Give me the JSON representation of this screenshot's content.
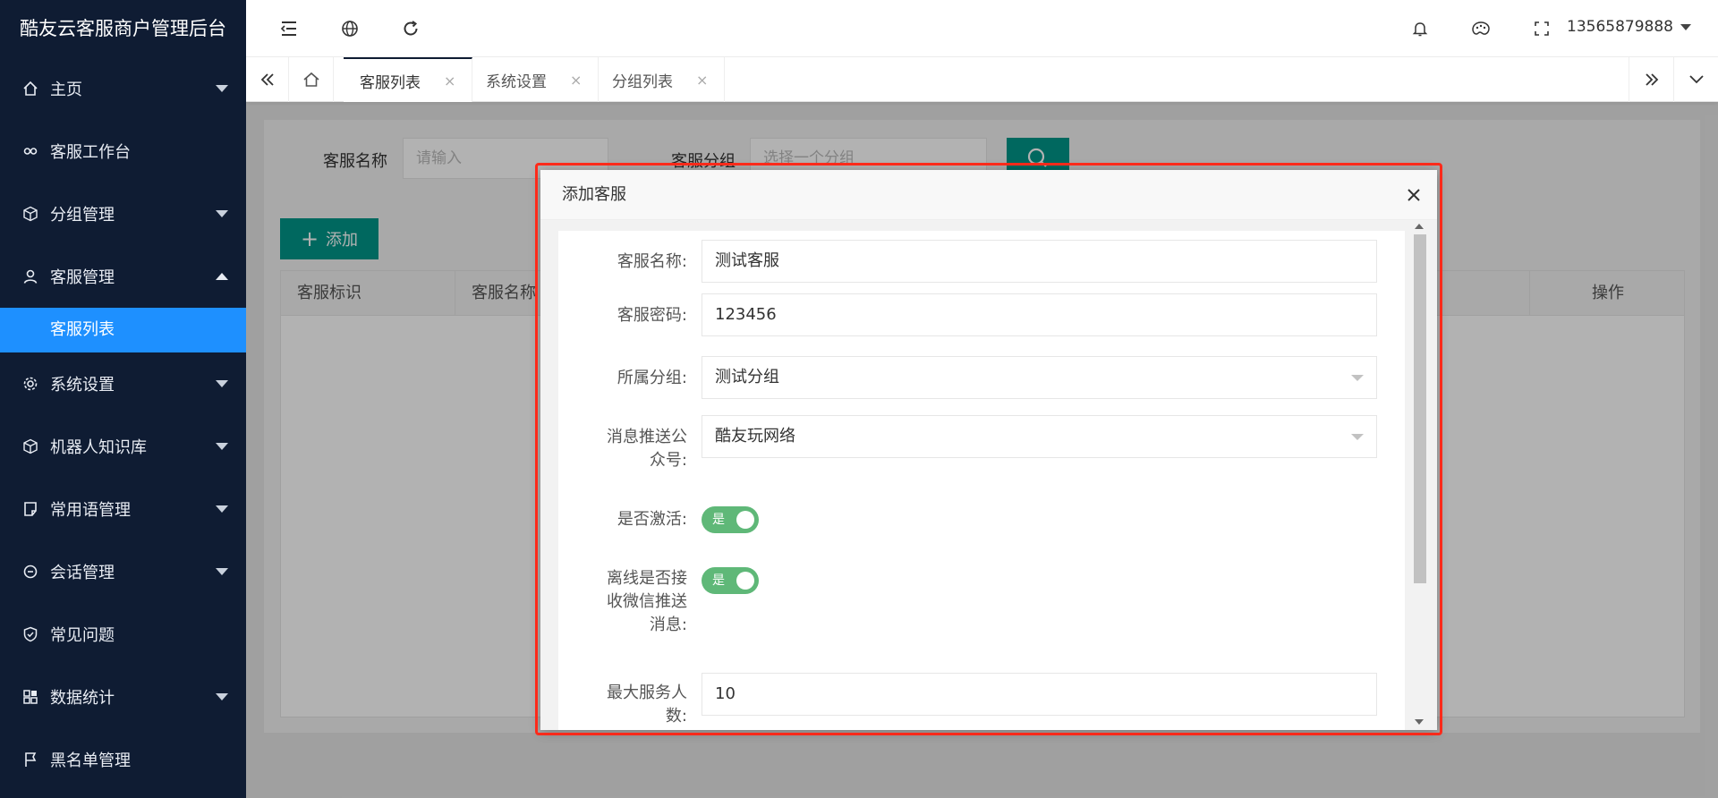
{
  "app": {
    "title": "酷友云客服商户管理后台"
  },
  "sidebar": {
    "items": [
      {
        "label": "主页",
        "icon": "home-icon",
        "caret": "down"
      },
      {
        "label": "客服工作台",
        "icon": "link-icon",
        "caret": ""
      },
      {
        "label": "分组管理",
        "icon": "cube-icon",
        "caret": "down"
      },
      {
        "label": "客服管理",
        "icon": "user-icon",
        "caret": "up"
      },
      {
        "label": "系统设置",
        "icon": "gear-icon",
        "caret": "down"
      },
      {
        "label": "机器人知识库",
        "icon": "cube-icon",
        "caret": "down"
      },
      {
        "label": "常用语管理",
        "icon": "note-icon",
        "caret": "down"
      },
      {
        "label": "会话管理",
        "icon": "chat-icon",
        "caret": "down"
      },
      {
        "label": "常见问题",
        "icon": "shield-icon",
        "caret": ""
      },
      {
        "label": "数据统计",
        "icon": "grid-icon",
        "caret": "down"
      },
      {
        "label": "黑名单管理",
        "icon": "flag-icon",
        "caret": ""
      }
    ],
    "sub_active": "客服列表"
  },
  "header": {
    "user": "13565879888"
  },
  "tabs": {
    "items": [
      {
        "label": "客服列表",
        "close": "×"
      },
      {
        "label": "系统设置",
        "close": "×"
      },
      {
        "label": "分组列表",
        "close": "×"
      }
    ]
  },
  "search": {
    "name_label": "客服名称",
    "name_placeholder": "请输入",
    "group_label": "客服分组",
    "group_placeholder": "选择一个分组"
  },
  "toolbar": {
    "add_label": "添加"
  },
  "table": {
    "headers": [
      "客服标识",
      "客服名称",
      "操作"
    ]
  },
  "dialog": {
    "title": "添加客服",
    "fields": {
      "name": {
        "label": "客服名称:",
        "value": "测试客服"
      },
      "password": {
        "label": "客服密码:",
        "value": "123456"
      },
      "group": {
        "label": "所属分组:",
        "value": "测试分组"
      },
      "account": {
        "label_line1": "消息推送公",
        "label_line2": "众号:",
        "value": "酷友玩网络"
      },
      "active": {
        "label": "是否激活:",
        "switch_text": "是"
      },
      "offline": {
        "label_line1": "离线是否接",
        "label_line2": "收微信推送",
        "label_line3": "消息:",
        "switch_text": "是"
      },
      "max": {
        "label_line1": "最大服务人",
        "label_line2": "数:",
        "value": "10"
      }
    }
  },
  "colors": {
    "sidebar_bg": "#0f1c33",
    "active_blue": "#1e90ff",
    "teal": "#009688",
    "switch_green": "#5fb878",
    "highlight_red": "#ff2a1a"
  }
}
